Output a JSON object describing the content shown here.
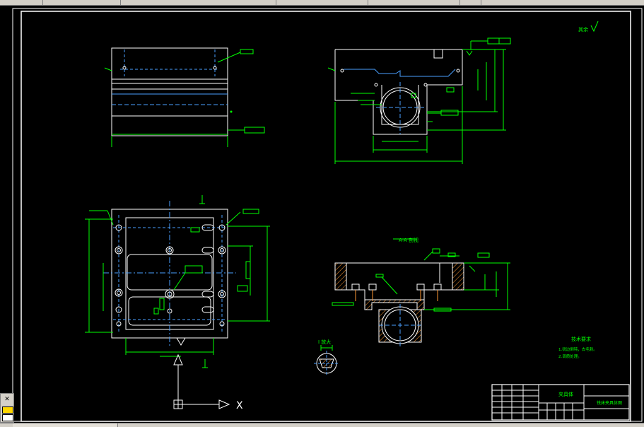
{
  "drawing": {
    "section_label": "A-A 剖视",
    "view_label": "I 放大",
    "surface_mark": "其余",
    "tech_title": "技术要求",
    "tech_lines": [
      "1.锐边倒钝，去毛刺。",
      "2.调质处理。"
    ],
    "title_block": {
      "part_name": "夹具体",
      "drawing_name": "铣床夹具体图"
    },
    "ucs": {
      "x_label": "X"
    }
  },
  "colors": {
    "background": "#000000",
    "outline": "#ffffff",
    "dimension": "#00ff00",
    "center": "#4aa0ff",
    "hatch": "#ff9933",
    "frame": "#ffffff"
  }
}
